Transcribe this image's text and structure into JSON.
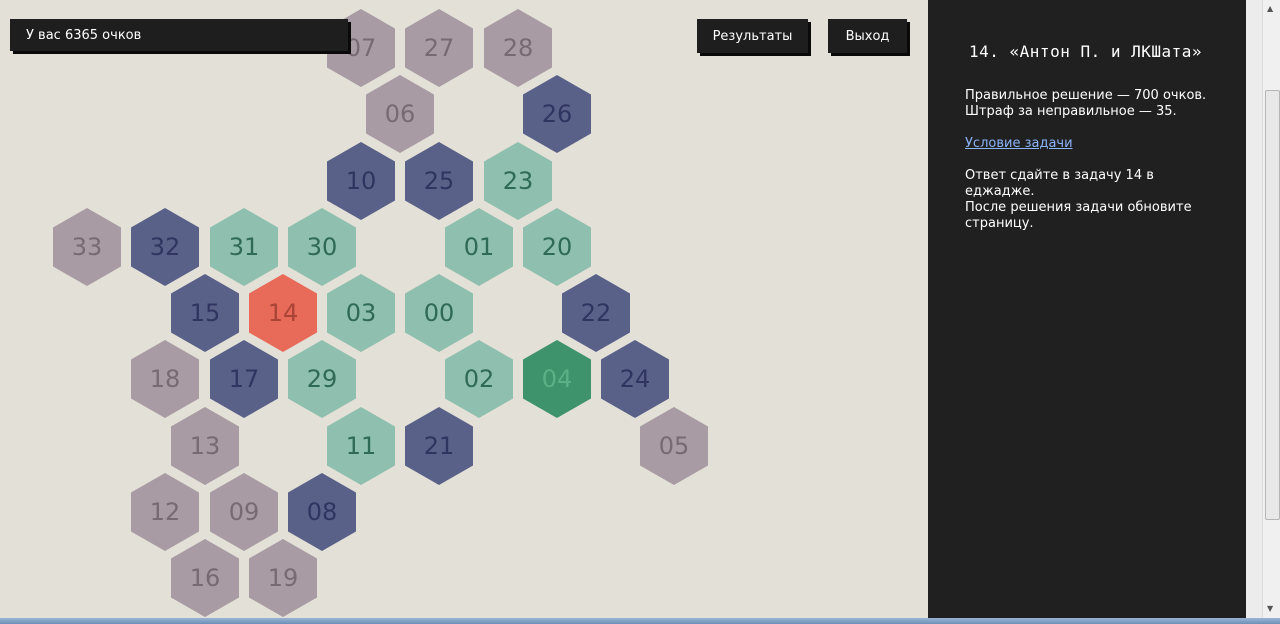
{
  "header": {
    "score_text": "У вас 6365 очков",
    "results_label": "Результаты",
    "exit_label": "Выход"
  },
  "hexes": [
    {
      "label": "07",
      "color": "purple"
    },
    {
      "label": "27",
      "color": "purple"
    },
    {
      "label": "28",
      "color": "purple"
    },
    {
      "label": "06",
      "color": "purple"
    },
    {
      "label": "26",
      "color": "navy"
    },
    {
      "label": "10",
      "color": "navy"
    },
    {
      "label": "25",
      "color": "navy"
    },
    {
      "label": "23",
      "color": "teal"
    },
    {
      "label": "33",
      "color": "purple"
    },
    {
      "label": "32",
      "color": "navy"
    },
    {
      "label": "31",
      "color": "teal"
    },
    {
      "label": "30",
      "color": "teal"
    },
    {
      "label": "01",
      "color": "teal"
    },
    {
      "label": "20",
      "color": "teal"
    },
    {
      "label": "15",
      "color": "navy"
    },
    {
      "label": "14",
      "color": "red"
    },
    {
      "label": "03",
      "color": "teal"
    },
    {
      "label": "00",
      "color": "teal"
    },
    {
      "label": "22",
      "color": "navy"
    },
    {
      "label": "18",
      "color": "purple"
    },
    {
      "label": "17",
      "color": "navy"
    },
    {
      "label": "29",
      "color": "teal"
    },
    {
      "label": "02",
      "color": "teal"
    },
    {
      "label": "04",
      "color": "green"
    },
    {
      "label": "24",
      "color": "navy"
    },
    {
      "label": "13",
      "color": "purple"
    },
    {
      "label": "11",
      "color": "teal"
    },
    {
      "label": "21",
      "color": "navy"
    },
    {
      "label": "05",
      "color": "purple"
    },
    {
      "label": "12",
      "color": "purple"
    },
    {
      "label": "09",
      "color": "purple"
    },
    {
      "label": "08",
      "color": "navy"
    },
    {
      "label": "16",
      "color": "purple"
    },
    {
      "label": "19",
      "color": "purple"
    }
  ],
  "panel": {
    "title": "14. «Антон П. и ЛКШата»",
    "reward_line": "Правильное решение — 700 очков.",
    "penalty_line": "Штраф за неправильное — 35.",
    "task_link": "Условие задачи",
    "instructions_1": "Ответ сдайте в задачу 14 в еджадже.",
    "instructions_2": "После решения задачи обновите страницу."
  },
  "colors": {
    "purple": "#a89ba3",
    "navy": "#5a6189",
    "teal": "#8fbfae",
    "green": "#3f936c",
    "red": "#e86a58",
    "panel_bg": "#202020",
    "board_bg": "#e3e0d7"
  }
}
